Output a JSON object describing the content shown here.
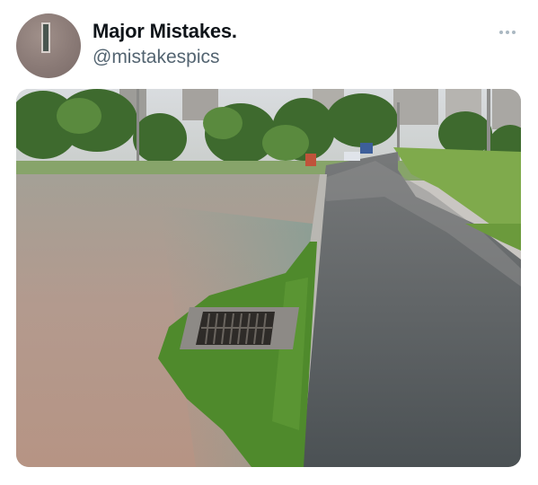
{
  "tweet": {
    "display_name": "Major Mistakes.",
    "handle": "@mistakespics",
    "more_icon": "more-horizontal-icon",
    "avatar_icon": "avatar-image",
    "media": {
      "type": "photo",
      "subject": "flooded park with submerged storm drain",
      "colors": {
        "water": "#b59a8c",
        "road": "#545a5c",
        "grass": "#4d8a2c",
        "grate": "#2e2b28"
      }
    }
  }
}
